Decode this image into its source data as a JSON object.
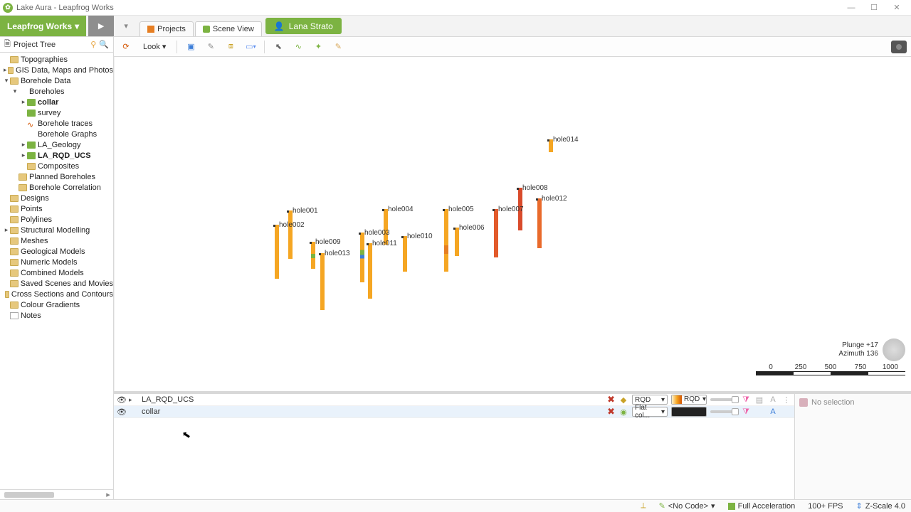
{
  "window": {
    "title": "Lake Aura - Leapfrog Works"
  },
  "appbar": {
    "brand": "Leapfrog Works",
    "tabs": {
      "projects": "Projects",
      "scene": "Scene View"
    },
    "user": "Lana Strato"
  },
  "project_tree": {
    "header": "Project Tree",
    "items": {
      "topographies": "Topographies",
      "gis": "GIS Data, Maps and Photos",
      "borehole_data": "Borehole Data",
      "boreholes": "Boreholes",
      "collar": "collar",
      "survey": "survey",
      "traces": "Borehole traces",
      "graphs": "Borehole Graphs",
      "la_geology": "LA_Geology",
      "la_rqd_ucs": "LA_RQD_UCS",
      "composites": "Composites",
      "planned": "Planned Boreholes",
      "correlation": "Borehole Correlation",
      "designs": "Designs",
      "points": "Points",
      "polylines": "Polylines",
      "structural": "Structural Modelling",
      "meshes": "Meshes",
      "geomodels": "Geological Models",
      "numeric": "Numeric Models",
      "combined": "Combined Models",
      "saved": "Saved Scenes and Movies",
      "cross": "Cross Sections and Contours",
      "gradients": "Colour Gradients",
      "notes": "Notes"
    }
  },
  "scene_toolbar": {
    "look": "Look"
  },
  "viewport": {
    "orientation": {
      "plunge": "Plunge  +17",
      "azimuth": "Azimuth  136"
    },
    "scale_ticks": [
      "0",
      "250",
      "500",
      "750",
      "1000"
    ],
    "holes": {
      "h001": "hole001",
      "h002": "hole002",
      "h003": "hole003",
      "h004": "hole004",
      "h005": "hole005",
      "h006": "hole006",
      "h007": "hole007",
      "h008": "hole008",
      "h009": "hole009",
      "h010": "hole010",
      "h011": "hole011",
      "h012": "hole012",
      "h013": "hole013",
      "h014": "hole014"
    }
  },
  "shapelist": {
    "rows": {
      "r0": {
        "name": "LA_RQD_UCS",
        "colorby": "RQD",
        "ramp": "RQD"
      },
      "r1": {
        "name": "collar",
        "colorby": "Flat col..."
      }
    }
  },
  "selection_panel": {
    "text": "No selection"
  },
  "statusbar": {
    "nocode": "<No Code>",
    "accel": "Full Acceleration",
    "fps": "100+ FPS",
    "zscale": "Z-Scale 4.0"
  }
}
